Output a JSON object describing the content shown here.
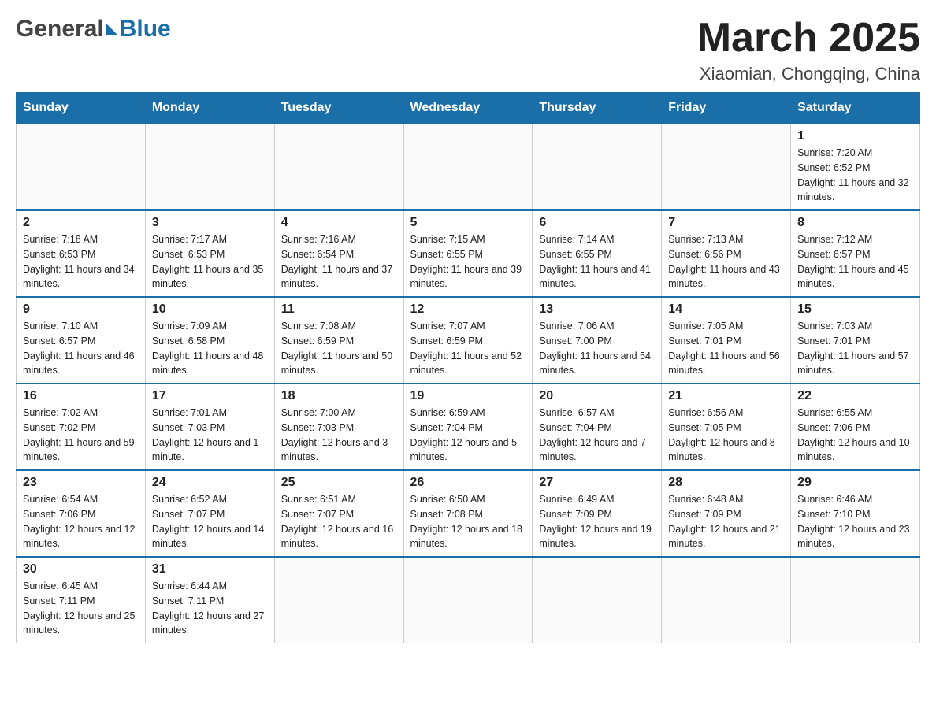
{
  "header": {
    "logo_general": "General",
    "logo_blue": "Blue",
    "month_title": "March 2025",
    "location": "Xiaomian, Chongqing, China"
  },
  "calendar": {
    "days_of_week": [
      "Sunday",
      "Monday",
      "Tuesday",
      "Wednesday",
      "Thursday",
      "Friday",
      "Saturday"
    ],
    "weeks": [
      [
        {
          "day": "",
          "info": ""
        },
        {
          "day": "",
          "info": ""
        },
        {
          "day": "",
          "info": ""
        },
        {
          "day": "",
          "info": ""
        },
        {
          "day": "",
          "info": ""
        },
        {
          "day": "",
          "info": ""
        },
        {
          "day": "1",
          "info": "Sunrise: 7:20 AM\nSunset: 6:52 PM\nDaylight: 11 hours and 32 minutes."
        }
      ],
      [
        {
          "day": "2",
          "info": "Sunrise: 7:18 AM\nSunset: 6:53 PM\nDaylight: 11 hours and 34 minutes."
        },
        {
          "day": "3",
          "info": "Sunrise: 7:17 AM\nSunset: 6:53 PM\nDaylight: 11 hours and 35 minutes."
        },
        {
          "day": "4",
          "info": "Sunrise: 7:16 AM\nSunset: 6:54 PM\nDaylight: 11 hours and 37 minutes."
        },
        {
          "day": "5",
          "info": "Sunrise: 7:15 AM\nSunset: 6:55 PM\nDaylight: 11 hours and 39 minutes."
        },
        {
          "day": "6",
          "info": "Sunrise: 7:14 AM\nSunset: 6:55 PM\nDaylight: 11 hours and 41 minutes."
        },
        {
          "day": "7",
          "info": "Sunrise: 7:13 AM\nSunset: 6:56 PM\nDaylight: 11 hours and 43 minutes."
        },
        {
          "day": "8",
          "info": "Sunrise: 7:12 AM\nSunset: 6:57 PM\nDaylight: 11 hours and 45 minutes."
        }
      ],
      [
        {
          "day": "9",
          "info": "Sunrise: 7:10 AM\nSunset: 6:57 PM\nDaylight: 11 hours and 46 minutes."
        },
        {
          "day": "10",
          "info": "Sunrise: 7:09 AM\nSunset: 6:58 PM\nDaylight: 11 hours and 48 minutes."
        },
        {
          "day": "11",
          "info": "Sunrise: 7:08 AM\nSunset: 6:59 PM\nDaylight: 11 hours and 50 minutes."
        },
        {
          "day": "12",
          "info": "Sunrise: 7:07 AM\nSunset: 6:59 PM\nDaylight: 11 hours and 52 minutes."
        },
        {
          "day": "13",
          "info": "Sunrise: 7:06 AM\nSunset: 7:00 PM\nDaylight: 11 hours and 54 minutes."
        },
        {
          "day": "14",
          "info": "Sunrise: 7:05 AM\nSunset: 7:01 PM\nDaylight: 11 hours and 56 minutes."
        },
        {
          "day": "15",
          "info": "Sunrise: 7:03 AM\nSunset: 7:01 PM\nDaylight: 11 hours and 57 minutes."
        }
      ],
      [
        {
          "day": "16",
          "info": "Sunrise: 7:02 AM\nSunset: 7:02 PM\nDaylight: 11 hours and 59 minutes."
        },
        {
          "day": "17",
          "info": "Sunrise: 7:01 AM\nSunset: 7:03 PM\nDaylight: 12 hours and 1 minute."
        },
        {
          "day": "18",
          "info": "Sunrise: 7:00 AM\nSunset: 7:03 PM\nDaylight: 12 hours and 3 minutes."
        },
        {
          "day": "19",
          "info": "Sunrise: 6:59 AM\nSunset: 7:04 PM\nDaylight: 12 hours and 5 minutes."
        },
        {
          "day": "20",
          "info": "Sunrise: 6:57 AM\nSunset: 7:04 PM\nDaylight: 12 hours and 7 minutes."
        },
        {
          "day": "21",
          "info": "Sunrise: 6:56 AM\nSunset: 7:05 PM\nDaylight: 12 hours and 8 minutes."
        },
        {
          "day": "22",
          "info": "Sunrise: 6:55 AM\nSunset: 7:06 PM\nDaylight: 12 hours and 10 minutes."
        }
      ],
      [
        {
          "day": "23",
          "info": "Sunrise: 6:54 AM\nSunset: 7:06 PM\nDaylight: 12 hours and 12 minutes."
        },
        {
          "day": "24",
          "info": "Sunrise: 6:52 AM\nSunset: 7:07 PM\nDaylight: 12 hours and 14 minutes."
        },
        {
          "day": "25",
          "info": "Sunrise: 6:51 AM\nSunset: 7:07 PM\nDaylight: 12 hours and 16 minutes."
        },
        {
          "day": "26",
          "info": "Sunrise: 6:50 AM\nSunset: 7:08 PM\nDaylight: 12 hours and 18 minutes."
        },
        {
          "day": "27",
          "info": "Sunrise: 6:49 AM\nSunset: 7:09 PM\nDaylight: 12 hours and 19 minutes."
        },
        {
          "day": "28",
          "info": "Sunrise: 6:48 AM\nSunset: 7:09 PM\nDaylight: 12 hours and 21 minutes."
        },
        {
          "day": "29",
          "info": "Sunrise: 6:46 AM\nSunset: 7:10 PM\nDaylight: 12 hours and 23 minutes."
        }
      ],
      [
        {
          "day": "30",
          "info": "Sunrise: 6:45 AM\nSunset: 7:11 PM\nDaylight: 12 hours and 25 minutes."
        },
        {
          "day": "31",
          "info": "Sunrise: 6:44 AM\nSunset: 7:11 PM\nDaylight: 12 hours and 27 minutes."
        },
        {
          "day": "",
          "info": ""
        },
        {
          "day": "",
          "info": ""
        },
        {
          "day": "",
          "info": ""
        },
        {
          "day": "",
          "info": ""
        },
        {
          "day": "",
          "info": ""
        }
      ]
    ]
  }
}
